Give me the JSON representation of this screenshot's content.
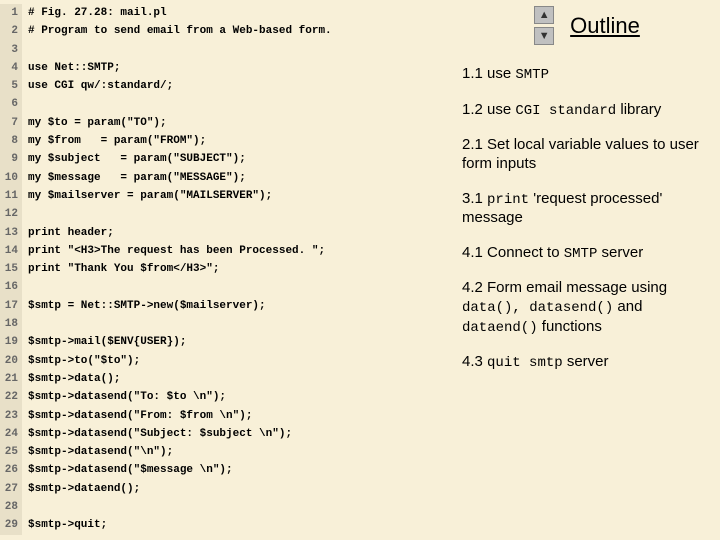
{
  "code": {
    "lines": [
      "# Fig. 27.28: mail.pl",
      "# Program to send email from a Web-based form.",
      "",
      "use Net::SMTP;",
      "use CGI qw/:standard/;",
      "",
      "my $to = param(\"TO\");",
      "my $from   = param(\"FROM\");",
      "my $subject   = param(\"SUBJECT\");",
      "my $message   = param(\"MESSAGE\");",
      "my $mailserver = param(\"MAILSERVER\");",
      "",
      "print header;",
      "print \"<H3>The request has been Processed. \";",
      "print \"Thank You $from</H3>\";",
      "",
      "$smtp = Net::SMTP->new($mailserver);",
      "",
      "$smtp->mail($ENV{USER});",
      "$smtp->to(\"$to\");",
      "$smtp->data();",
      "$smtp->datasend(\"To: $to \\n\");",
      "$smtp->datasend(\"From: $from \\n\");",
      "$smtp->datasend(\"Subject: $subject \\n\");",
      "$smtp->datasend(\"\\n\");",
      "$smtp->datasend(\"$message \\n\");",
      "$smtp->dataend();",
      "",
      "$smtp->quit;"
    ]
  },
  "outline": {
    "title": "Outline",
    "items": [
      {
        "num": "1.1",
        "pre": "use ",
        "mono": "SMTP",
        "post": ""
      },
      {
        "num": "1.2",
        "pre": "use ",
        "mono": "CGI standard",
        "post": " library"
      },
      {
        "num": "2.1",
        "pre": "Set local variable values to user form inputs",
        "mono": "",
        "post": ""
      },
      {
        "num": "3.1",
        "pre": "",
        "mono": "print",
        "post": " 'request processed' message"
      },
      {
        "num": "4.1",
        "pre": "Connect to ",
        "mono": "SMTP",
        "post": " server"
      },
      {
        "num": "4.2",
        "pre": "Form email message using ",
        "mono": "data(), datasend()",
        "post": " and ",
        "mono2": "dataend()",
        "post2": " functions"
      },
      {
        "num": "4.3",
        "pre": "",
        "mono": "quit smtp",
        "post": " server"
      }
    ]
  }
}
